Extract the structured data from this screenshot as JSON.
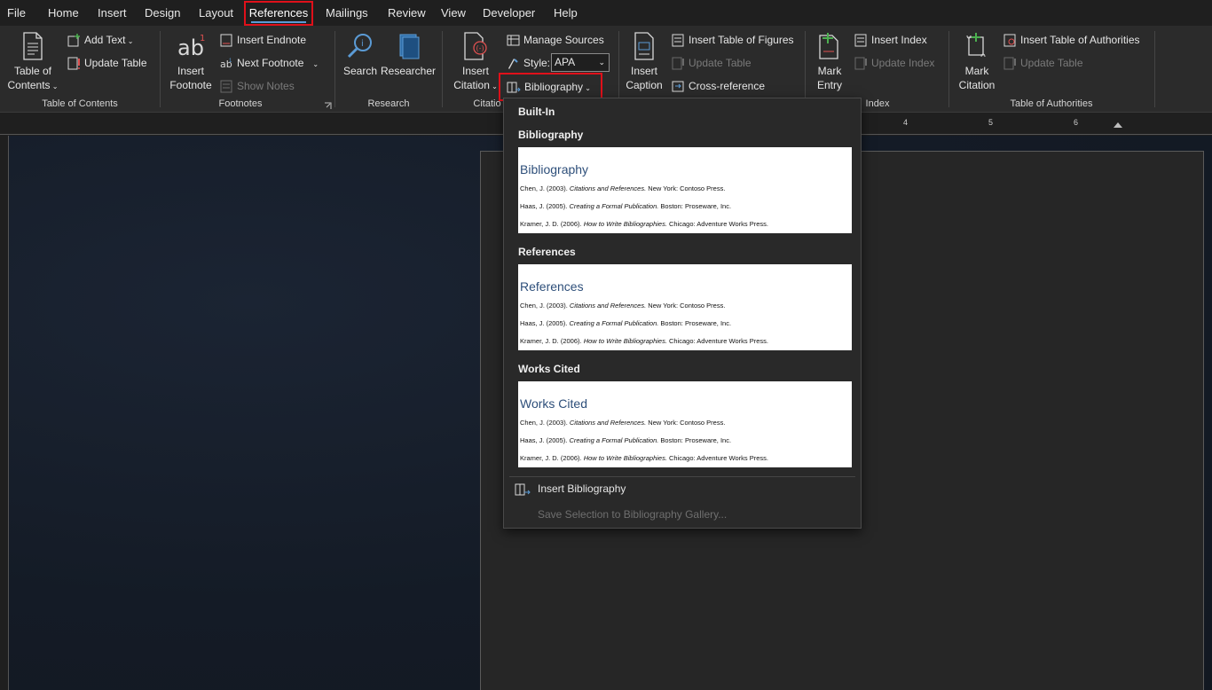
{
  "menu": {
    "tabs": [
      "File",
      "Home",
      "Insert",
      "Design",
      "Layout",
      "References",
      "Mailings",
      "Review",
      "View",
      "Developer",
      "Help"
    ],
    "active_tab": "References"
  },
  "ribbon": {
    "toc": {
      "table_of_contents": "Table of",
      "table_of_contents_2": "Contents",
      "add_text": "Add Text",
      "update_table": "Update Table",
      "group": "Table of Contents"
    },
    "footnotes": {
      "insert_footnote": "Insert",
      "insert_footnote_2": "Footnote",
      "insert_endnote": "Insert Endnote",
      "next_footnote": "Next Footnote",
      "show_notes": "Show Notes",
      "group": "Footnotes"
    },
    "research": {
      "search": "Search",
      "researcher": "Researcher",
      "group": "Research"
    },
    "citations": {
      "insert_citation": "Insert",
      "insert_citation_2": "Citation",
      "manage_sources": "Manage Sources",
      "style_label": "Style:",
      "style_value": "APA",
      "bibliography": "Bibliography",
      "group": "Citatio"
    },
    "captions": {
      "insert_caption": "Insert",
      "insert_caption_2": "Caption",
      "insert_table_of_figures": "Insert Table of Figures",
      "update_table": "Update Table",
      "cross_reference": "Cross-reference"
    },
    "index": {
      "mark_entry": "Mark",
      "mark_entry_2": "Entry",
      "insert_index": "Insert Index",
      "update_index": "Update Index",
      "group": "Index"
    },
    "authorities": {
      "mark_citation": "Mark",
      "mark_citation_2": "Citation",
      "insert_toa": "Insert Table of Authorities",
      "update_table": "Update Table",
      "group": "Table of Authorities"
    }
  },
  "ruler": {
    "numbers": [
      "4",
      "5",
      "6"
    ]
  },
  "dropdown": {
    "section": "Built-In",
    "options": [
      {
        "heading": "Bibliography",
        "title": "Bibliography",
        "entries": [
          {
            "pre": "Chen, J. (2003). ",
            "ital": "Citations and References.",
            "post": " New York: Contoso Press."
          },
          {
            "pre": "Haas, J. (2005). ",
            "ital": "Creating a Formal Publication.",
            "post": " Boston: Proseware, Inc."
          },
          {
            "pre": "Kramer, J. D. (2006). ",
            "ital": "How to Write Bibliographies.",
            "post": " Chicago: Adventure Works Press."
          }
        ]
      },
      {
        "heading": "References",
        "title": "References",
        "entries": [
          {
            "pre": "Chen, J. (2003). ",
            "ital": "Citations and References.",
            "post": " New York: Contoso Press."
          },
          {
            "pre": "Haas, J. (2005). ",
            "ital": "Creating a Formal Publication.",
            "post": " Boston: Proseware, Inc."
          },
          {
            "pre": "Kramer, J. D. (2006). ",
            "ital": "How to Write Bibliographies.",
            "post": " Chicago: Adventure Works Press."
          }
        ]
      },
      {
        "heading": "Works Cited",
        "title": "Works Cited",
        "entries": [
          {
            "pre": "Chen, J. (2003). ",
            "ital": "Citations and References.",
            "post": " New York: Contoso Press."
          },
          {
            "pre": "Haas, J. (2005). ",
            "ital": "Creating a Formal Publication.",
            "post": " Boston: Proseware, Inc."
          },
          {
            "pre": "Kramer, J. D. (2006). ",
            "ital": "How to Write Bibliographies.",
            "post": " Chicago: Adventure Works Press."
          }
        ]
      }
    ],
    "insert_bibliography": "Insert Bibliography",
    "save_selection": "Save Selection to Bibliography Gallery..."
  },
  "colors": {
    "highlight": "#e0101a",
    "accent": "#5b9bd5",
    "preview_title": "#2e4f7a"
  }
}
